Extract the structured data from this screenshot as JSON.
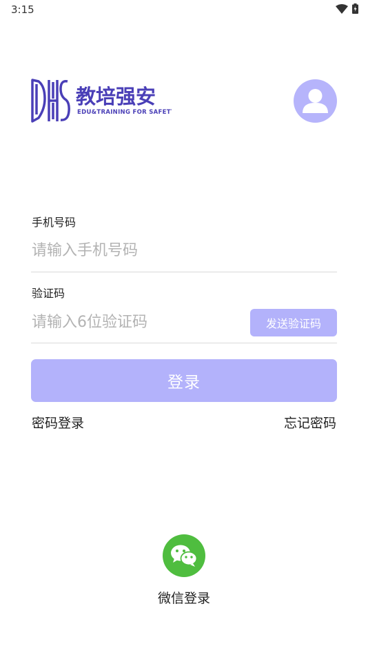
{
  "status_bar": {
    "time": "3:15"
  },
  "header": {
    "logo_letters": "DHS",
    "logo_title": "教培强安",
    "logo_subtitle": "EDU&TRAINING FOR SAFETY"
  },
  "form": {
    "phone": {
      "label": "手机号码",
      "placeholder": "请输入手机号码"
    },
    "code": {
      "label": "验证码",
      "placeholder": "请输入6位验证码",
      "send_button": "发送验证码"
    },
    "login_button": "登录",
    "password_login": "密码登录",
    "forgot_password": "忘记密码"
  },
  "wechat": {
    "label": "微信登录"
  },
  "colors": {
    "brand": "#4a3fb7",
    "button": "#b3b2fb",
    "avatar": "#b6b4fb",
    "wechat": "#4fbd3f"
  }
}
